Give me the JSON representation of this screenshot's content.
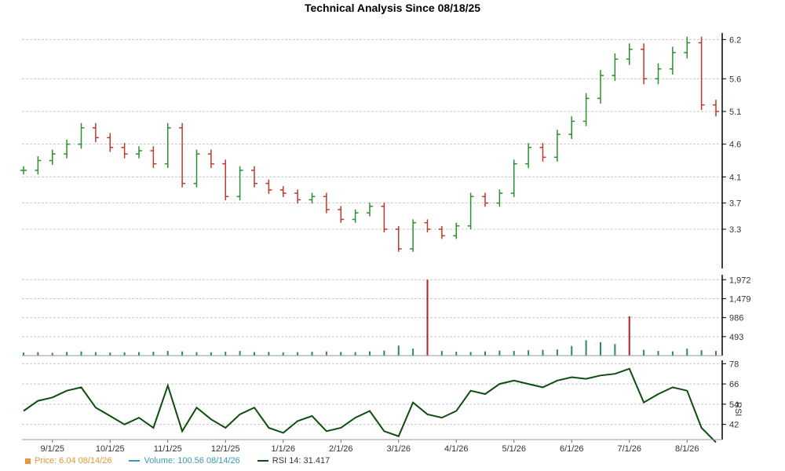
{
  "colors": {
    "up": "#2f8f2f",
    "down": "#c0392b",
    "volume": "#2e8b57",
    "volume_spike": "#b22222",
    "rsi": "#0d4d0d",
    "grid": "#c8c8c8",
    "price_legend": "#e8953a",
    "volume_legend": "#3a9ab5"
  },
  "chart_data": [
    {
      "type": "line",
      "name": "price",
      "title": "Technical Analysis Since 08/18/25",
      "grid": true,
      "y_ticks": [
        "3.3",
        "3.7",
        "4.1",
        "4.6",
        "5.1",
        "5.6",
        "6.2"
      ],
      "x_ticks": [
        "9/1/25",
        "10/1/25",
        "11/1/25",
        "12/1/25",
        "1/1/26",
        "2/1/26",
        "3/1/26",
        "4/1/26",
        "5/1/26",
        "6/1/26",
        "7/1/26",
        "8/1/26"
      ],
      "ylim": [
        2.7,
        6.3
      ],
      "x": [
        "8/18/25",
        "8/25/25",
        "9/1/25",
        "9/8/25",
        "9/15/25",
        "9/22/25",
        "10/1/25",
        "10/8/25",
        "10/15/25",
        "10/22/25",
        "11/1/25",
        "11/8/25",
        "11/15/25",
        "11/22/25",
        "12/1/25",
        "12/8/25",
        "12/15/25",
        "12/22/25",
        "1/1/26",
        "1/8/26",
        "1/15/26",
        "1/22/26",
        "2/1/26",
        "2/8/26",
        "2/15/26",
        "2/22/26",
        "3/1/26",
        "3/8/26",
        "3/15/26",
        "3/22/26",
        "4/1/26",
        "4/8/26",
        "4/15/26",
        "4/22/26",
        "5/1/26",
        "5/8/26",
        "5/15/26",
        "5/22/26",
        "6/1/26",
        "6/8/26",
        "6/15/26",
        "6/22/26",
        "7/1/26",
        "7/8/26",
        "7/15/26",
        "7/22/26",
        "8/1/26",
        "8/8/26",
        "8/14/26"
      ],
      "values": [
        4.2,
        4.35,
        4.45,
        4.6,
        4.85,
        4.7,
        4.55,
        4.45,
        4.5,
        4.3,
        4.85,
        4.0,
        4.45,
        4.3,
        3.8,
        4.2,
        4.0,
        3.9,
        3.85,
        3.75,
        3.8,
        3.6,
        3.45,
        3.55,
        3.65,
        3.3,
        3.0,
        3.4,
        3.3,
        3.2,
        3.35,
        3.8,
        3.7,
        3.85,
        4.3,
        4.55,
        4.4,
        4.75,
        4.95,
        5.3,
        5.65,
        5.9,
        6.05,
        5.6,
        5.75,
        6.0,
        6.15,
        5.2,
        5.1
      ]
    },
    {
      "type": "bar",
      "name": "volume",
      "y_ticks": [
        "493",
        "986",
        "1,479",
        "1,972"
      ],
      "ylim": [
        0,
        2100
      ],
      "x": [
        "8/18/25",
        "8/25/25",
        "9/1/25",
        "9/8/25",
        "9/15/25",
        "9/22/25",
        "10/1/25",
        "10/8/25",
        "10/15/25",
        "10/22/25",
        "11/1/25",
        "11/8/25",
        "11/15/25",
        "11/22/25",
        "12/1/25",
        "12/8/25",
        "12/15/25",
        "12/22/25",
        "1/1/26",
        "1/8/26",
        "1/15/26",
        "1/22/26",
        "2/1/26",
        "2/8/26",
        "2/15/26",
        "2/22/26",
        "3/1/26",
        "3/8/26",
        "3/15/26",
        "3/22/26",
        "4/1/26",
        "4/8/26",
        "4/15/26",
        "4/22/26",
        "5/1/26",
        "5/8/26",
        "5/15/26",
        "5/22/26",
        "6/1/26",
        "6/8/26",
        "6/15/26",
        "6/22/26",
        "7/1/26",
        "7/8/26",
        "7/15/26",
        "7/22/26",
        "8/1/26",
        "8/8/26",
        "8/14/26"
      ],
      "values": [
        80,
        90,
        70,
        95,
        110,
        90,
        80,
        85,
        90,
        100,
        120,
        110,
        90,
        85,
        100,
        120,
        90,
        95,
        85,
        90,
        100,
        110,
        95,
        90,
        110,
        130,
        260,
        180,
        1972,
        120,
        100,
        95,
        110,
        130,
        120,
        140,
        150,
        160,
        250,
        400,
        350,
        300,
        1020,
        150,
        120,
        110,
        180,
        140,
        120
      ]
    },
    {
      "type": "line",
      "name": "rsi",
      "y_ticks": [
        "42",
        "54",
        "66",
        "78"
      ],
      "ylim": [
        33,
        80
      ],
      "x": [
        "8/18/25",
        "8/25/25",
        "9/1/25",
        "9/8/25",
        "9/15/25",
        "9/22/25",
        "10/1/25",
        "10/8/25",
        "10/15/25",
        "10/22/25",
        "11/1/25",
        "11/8/25",
        "11/15/25",
        "11/22/25",
        "12/1/25",
        "12/8/25",
        "12/15/25",
        "12/22/25",
        "1/1/26",
        "1/8/26",
        "1/15/26",
        "1/22/26",
        "2/1/26",
        "2/8/26",
        "2/15/26",
        "2/22/26",
        "3/1/26",
        "3/8/26",
        "3/15/26",
        "3/22/26",
        "4/1/26",
        "4/8/26",
        "4/15/26",
        "4/22/26",
        "5/1/26",
        "5/8/26",
        "5/15/26",
        "5/22/26",
        "6/1/26",
        "6/8/26",
        "6/15/26",
        "6/22/26",
        "7/1/26",
        "7/8/26",
        "7/15/26",
        "7/22/26",
        "8/1/26",
        "8/8/26",
        "8/14/26"
      ],
      "values": [
        50,
        56,
        58,
        62,
        64,
        52,
        47,
        42,
        46,
        40,
        65,
        38,
        52,
        45,
        40,
        48,
        52,
        40,
        37,
        44,
        47,
        38,
        40,
        46,
        50,
        38,
        35,
        55,
        48,
        46,
        50,
        62,
        60,
        66,
        68,
        66,
        64,
        68,
        70,
        69,
        71,
        72,
        75,
        55,
        60,
        64,
        62,
        40,
        31.4
      ]
    }
  ],
  "legend": {
    "price": "Price: 6.04  08/14/26",
    "volume": "Volume: 100.56  08/14/26",
    "rsi": "RSI 14: 31.417"
  },
  "rsi_axis_label": "RSI"
}
